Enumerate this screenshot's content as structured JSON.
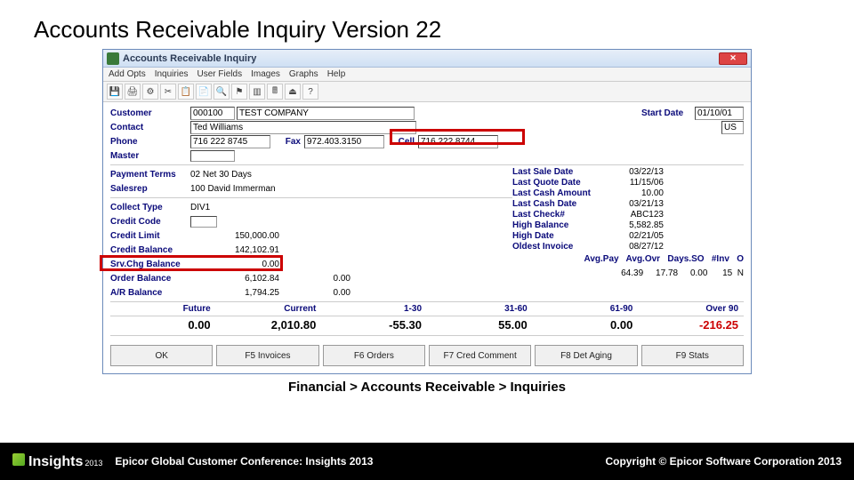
{
  "slide": {
    "title": "Accounts Receivable Inquiry Version 22",
    "breadcrumb": "Financial > Accounts Receivable > Inquiries"
  },
  "window": {
    "title": "Accounts Receivable Inquiry"
  },
  "menu": {
    "items": [
      "Add Opts",
      "Inquiries",
      "User Fields",
      "Images",
      "Graphs",
      "Help"
    ]
  },
  "header": {
    "customer_label": "Customer",
    "customer_code": "000100",
    "customer_name": "TEST COMPANY",
    "contact_label": "Contact",
    "contact": "Ted Williams",
    "phone_label": "Phone",
    "phone": "716 222 8745",
    "fax_label": "Fax",
    "fax": "972.403.3150",
    "cell_label": "Cell",
    "cell": "716 222 8744",
    "master_label": "Master",
    "start_date_label": "Start Date",
    "start_date": "01/10/01",
    "country": "US"
  },
  "terms": {
    "payment_terms_label": "Payment Terms",
    "payment_terms": "02 Net 30 Days",
    "salesrep_label": "Salesrep",
    "salesrep": "100 David Immerman"
  },
  "credit": {
    "collect_type_label": "Collect Type",
    "collect_type": "DIV1",
    "credit_code_label": "Credit Code",
    "credit_limit_label": "Credit Limit",
    "credit_limit": "150,000.00",
    "credit_balance_label": "Credit Balance",
    "credit_balance": "142,102.91",
    "srv_chg_label": "Srv.Chg Balance",
    "srv_chg": "0.00",
    "order_balance_label": "Order Balance",
    "order_balance": "6,102.84",
    "order_balance2": "0.00",
    "ar_balance_label": "A/R Balance",
    "ar_balance": "1,794.25",
    "ar_balance2": "0.00"
  },
  "right": {
    "last_sale_date_label": "Last Sale Date",
    "last_sale_date": "03/22/13",
    "last_quote_date_label": "Last Quote Date",
    "last_quote_date": "11/15/06",
    "last_cash_amount_label": "Last Cash Amount",
    "last_cash_amount": "10.00",
    "last_cash_date_label": "Last Cash Date",
    "last_cash_date": "03/21/13",
    "last_check_label": "Last Check#",
    "last_check": "ABC123",
    "high_balance_label": "High Balance",
    "high_balance": "5,582.85",
    "high_date_label": "High Date",
    "high_date": "02/21/05",
    "oldest_invoice_label": "Oldest Invoice",
    "oldest_invoice": "08/27/12",
    "avg_headers": "Avg.Pay   Avg.Ovr   Days.SO   #Inv   O",
    "avg_values": "64.39     17.78     0.00      15  N"
  },
  "aging": {
    "headers": [
      "Future",
      "Current",
      "1-30",
      "31-60",
      "61-90",
      "Over 90"
    ],
    "values": [
      "0.00",
      "2,010.80",
      "-55.30",
      "55.00",
      "0.00",
      "-216.25"
    ]
  },
  "buttons": {
    "ok": "OK",
    "f5": "F5 Invoices",
    "f6": "F6 Orders",
    "f7": "F7 Cred Comment",
    "f8": "F8 Det Aging",
    "f9": "F9 Stats"
  },
  "footer": {
    "logo": "Insights",
    "year": "2013",
    "conference": "Epicor Global Customer Conference: Insights 2013",
    "copyright": "Copyright © Epicor Software Corporation 2013"
  }
}
